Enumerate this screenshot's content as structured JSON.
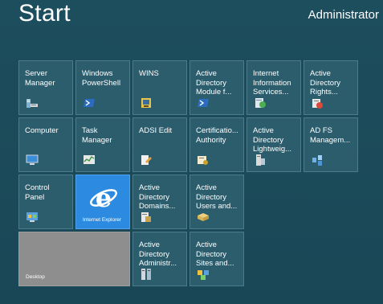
{
  "header": {
    "title": "Start",
    "user": "Administrator"
  },
  "tiles": {
    "server_manager": {
      "label": "Server\nManager",
      "icon": "server-manager-icon"
    },
    "windows_powershell": {
      "label": "Windows\nPowerShell",
      "icon": "powershell-icon"
    },
    "wins": {
      "label": "WINS",
      "icon": "wins-icon"
    },
    "ad_module": {
      "label": "Active\nDirectory\nModule f...",
      "icon": "powershell-icon"
    },
    "iis": {
      "label": "Internet\nInformation\nServices...",
      "icon": "iis-icon"
    },
    "ad_rights": {
      "label": "Active\nDirectory\nRights...",
      "icon": "rights-icon"
    },
    "computer": {
      "label": "Computer",
      "icon": "computer-icon"
    },
    "task_manager": {
      "label": "Task\nManager",
      "icon": "task-manager-icon"
    },
    "adsi_edit": {
      "label": "ADSI Edit",
      "icon": "adsi-icon"
    },
    "cert_authority": {
      "label": "Certificatio...\nAuthority",
      "icon": "certificate-icon"
    },
    "ad_lightweight": {
      "label": "Active\nDirectory\nLightweig...",
      "icon": "lightweight-icon"
    },
    "adfs": {
      "label": "AD FS\nManagem...",
      "icon": "adfs-icon"
    },
    "control_panel": {
      "label": "Control\nPanel",
      "icon": "control-panel-icon"
    },
    "internet_explorer": {
      "brand": "Internet Explorer",
      "icon": "ie-logo-icon",
      "color": "#2c8be0"
    },
    "ad_domains": {
      "label": "Active\nDirectory\nDomains...",
      "icon": "domains-icon"
    },
    "ad_users": {
      "label": "Active\nDirectory\nUsers and...",
      "icon": "users-icon"
    },
    "desktop": {
      "brand": "Desktop",
      "color": "#8e8e8e"
    },
    "ad_admin": {
      "label": "Active\nDirectory\nAdministr...",
      "icon": "admin-center-icon"
    },
    "ad_sites": {
      "label": "Active\nDirectory\nSites and...",
      "icon": "sites-icon"
    }
  },
  "colors": {
    "background": "#1b4a59",
    "tile": "#2b5d6d",
    "tile_border": "#4a7c8b"
  }
}
